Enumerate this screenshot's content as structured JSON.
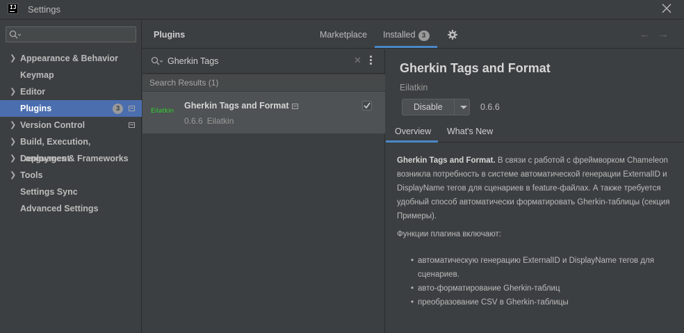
{
  "window": {
    "title": "Settings",
    "logo_text": "IJ"
  },
  "sidebar": {
    "search_value": "",
    "items": [
      {
        "label": "Appearance & Behavior",
        "expandable": true
      },
      {
        "label": "Keymap",
        "expandable": false
      },
      {
        "label": "Editor",
        "expandable": true
      },
      {
        "label": "Plugins",
        "expandable": false,
        "selected": true,
        "badge": "3"
      },
      {
        "label": "Version Control",
        "expandable": true
      },
      {
        "label": "Build, Execution, Deployment",
        "expandable": true
      },
      {
        "label": "Languages & Frameworks",
        "expandable": true
      },
      {
        "label": "Tools",
        "expandable": true
      },
      {
        "label": "Settings Sync",
        "expandable": false
      },
      {
        "label": "Advanced Settings",
        "expandable": false
      }
    ]
  },
  "header": {
    "title": "Plugins",
    "tabs": {
      "marketplace": "Marketplace",
      "installed": "Installed",
      "installed_count": "3"
    }
  },
  "plugin_list": {
    "search_query": "Gherkin Tags",
    "results_label": "Search Results (1)",
    "items": [
      {
        "name": "Gherkin Tags and Format",
        "version": "0.6.6",
        "vendor": "Eilatkin",
        "logo_text": "Eilatkin",
        "enabled": true
      }
    ]
  },
  "detail": {
    "title": "Gherkin Tags and Format",
    "vendor": "Eilatkin",
    "disable_label": "Disable",
    "version": "0.6.6",
    "tabs": {
      "overview": "Overview",
      "whats_new": "What's New"
    },
    "description_bold": "Gherkin Tags and Format.",
    "description_text": " В связи с работой с фреймворком Chameleon возникла потребность в системе автоматической генерации ExternalID и DisplayName тегов для сценариев в feature-файлах. А также требуется удобный способ автоматически форматировать Gherkin-таблицы (секция Примеры).",
    "features_intro": "Функции плагина включают:",
    "features": [
      "автоматическую генерацию ExternalID и DisplayName тегов для сценариев.",
      "авто-форматирование Gherkin-таблиц",
      "преобразование CSV в Gherkin-таблицы"
    ]
  },
  "colors": {
    "selected_bg": "#4b6eaf",
    "accent_tab": "#4a88c7",
    "plugin_logo": "#2fd62f"
  }
}
